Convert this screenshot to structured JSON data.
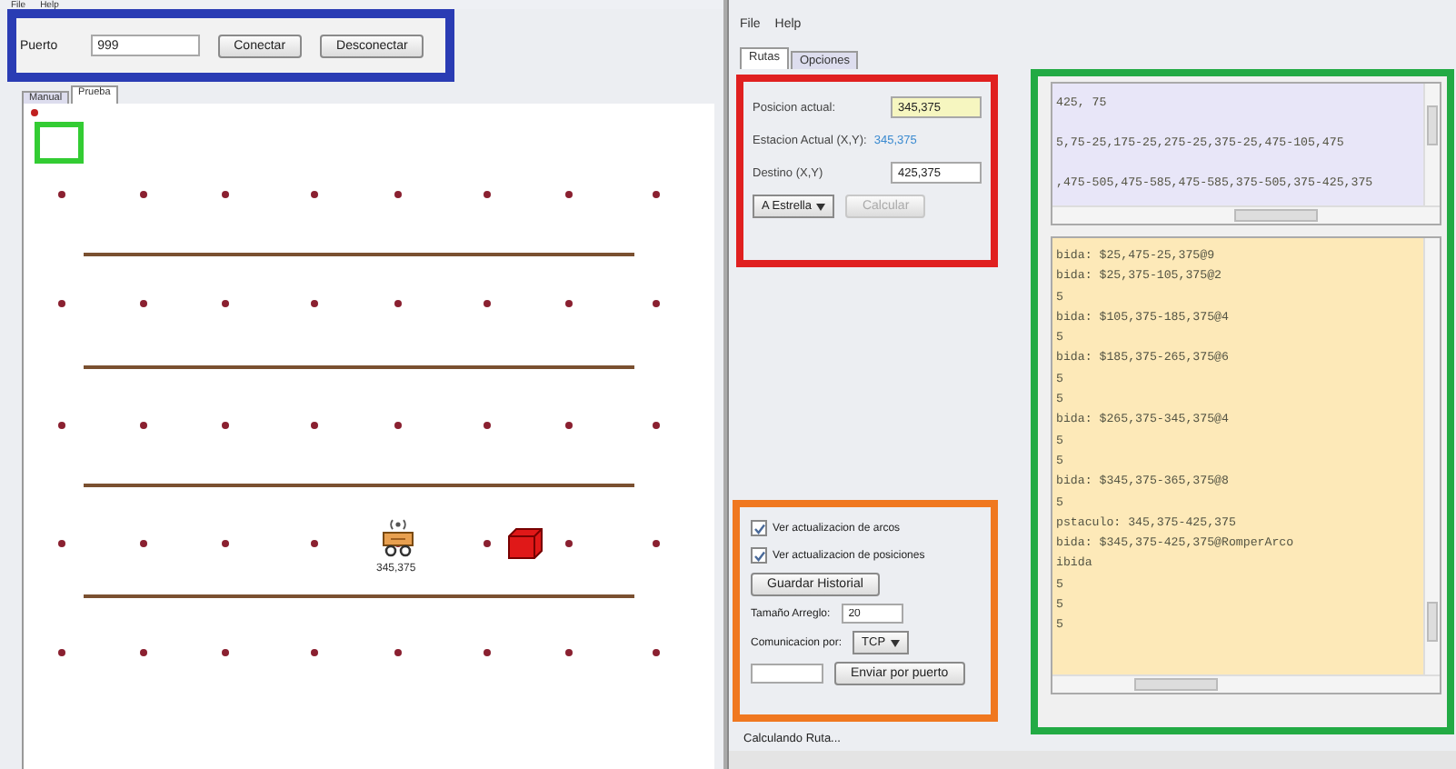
{
  "left_window": {
    "menu": [
      "File",
      "Help"
    ],
    "connection_bar": {
      "color": "#2a3cb4",
      "port_label": "Puerto",
      "port_value": "999",
      "buttons": [
        "Conectar",
        "Desconectar"
      ]
    },
    "tabs": [
      {
        "label": "Manual",
        "selected": false
      },
      {
        "label": "Prueba",
        "selected": true
      }
    ],
    "map": {
      "start_marker": {
        "color": "#33cc33"
      },
      "vehicle": {
        "label": "345,375"
      }
    }
  },
  "right_window": {
    "menu": [
      "File",
      "Help"
    ],
    "tabs": [
      {
        "label": "Rutas",
        "selected": true
      },
      {
        "label": "Opciones",
        "selected": false
      }
    ],
    "route_panel": {
      "color": "#e02020",
      "fields": [
        {
          "kind": "input",
          "label": "Posicion actual:",
          "value": "345,375",
          "highlighted": true
        },
        {
          "kind": "readout",
          "label": "Estacion Actual (X,Y):",
          "value": "345,375"
        },
        {
          "kind": "input",
          "label": "Destino (X,Y)",
          "value": "425,375",
          "highlighted": false
        }
      ],
      "algorithm": "A Estrella",
      "calculate": {
        "label": "Calcular",
        "disabled": true
      }
    },
    "options_panel": {
      "color": "#f07820",
      "checkboxes": [
        {
          "label": "Ver actualizacion de arcos",
          "checked": true
        },
        {
          "label": "Ver actualizacion de posiciones",
          "checked": true
        }
      ],
      "save_button": "Guardar Historial",
      "array_size": {
        "label": "Tamaño Arreglo:",
        "value": "20"
      },
      "communication": {
        "label": "Comunicacion por:",
        "value": "TCP"
      },
      "send_button": "Enviar por puerto"
    },
    "status": "Calculando Ruta...",
    "log_panel": {
      "color": "#22aa44",
      "route_lines": [
        "425, 75",
        "5,75-25,175-25,275-25,375-25,475-105,475",
        ",475-505,475-585,475-585,375-505,375-425,375"
      ],
      "event_lines": [
        "bida: $25,475-25,375@9",
        "bida: $25,375-105,375@2",
        "5",
        "bida: $105,375-185,375@4",
        "5",
        "bida: $185,375-265,375@6",
        "5",
        "5",
        "bida: $265,375-345,375@4",
        "5",
        "5",
        "bida: $345,375-365,375@8",
        "5",
        "pstaculo: 345,375-425,375",
        "bida: $345,375-425,375@RomperArco",
        "ibida",
        "5",
        "5",
        "5"
      ]
    }
  }
}
